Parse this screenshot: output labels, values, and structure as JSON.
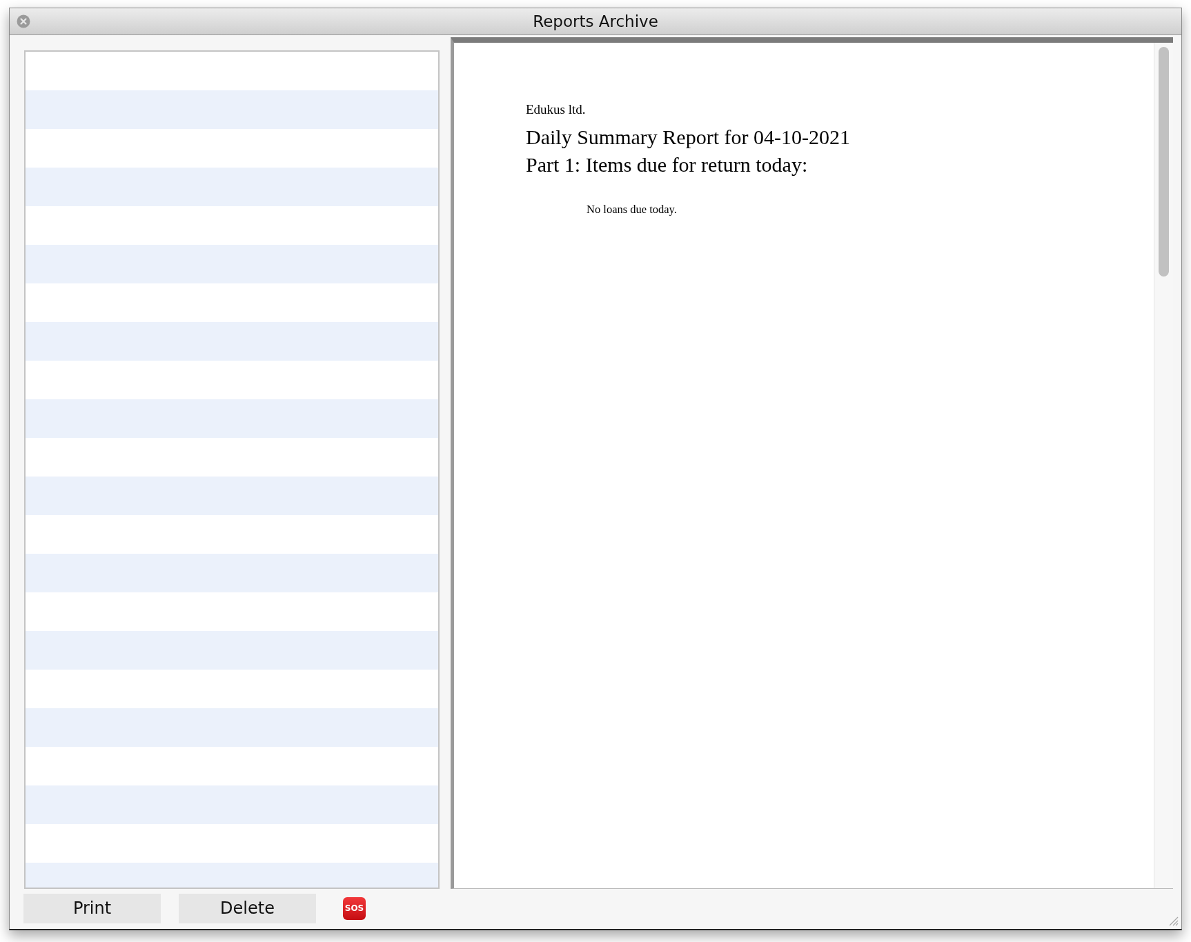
{
  "window": {
    "title": "Reports Archive"
  },
  "report": {
    "company": "Edukus ltd.",
    "title": "Daily Summary Report for 04-10-2021",
    "section": "Part 1: Items due for return today:",
    "note": "No loans due today."
  },
  "buttons": [
    {
      "kind": "text",
      "label": "Print"
    },
    {
      "kind": "text",
      "label": "Delete"
    },
    {
      "kind": "sos",
      "label": "SOS"
    }
  ]
}
